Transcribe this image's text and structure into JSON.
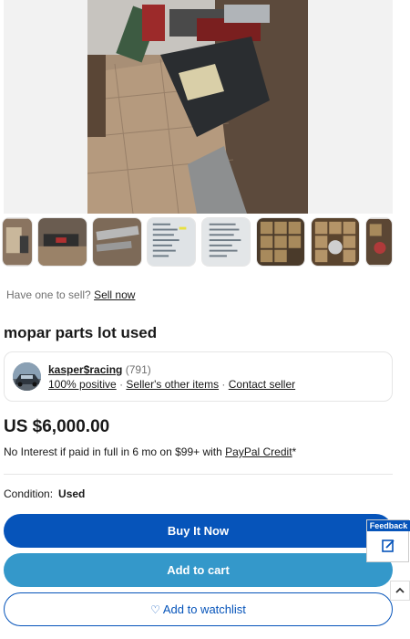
{
  "sell_prompt": {
    "text": "Have one to sell?",
    "link": "Sell now"
  },
  "listing": {
    "title": "mopar parts lot used"
  },
  "seller": {
    "name": "kasper$racing",
    "feedback_count": "(791)",
    "positive": "100% positive",
    "other_items": "Seller's other items",
    "contact": "Contact seller",
    "separator": "·"
  },
  "price": {
    "amount": "US $6,000.00"
  },
  "financing": {
    "text": "No Interest if paid in full in 6 mo on $99+ with",
    "link": "PayPal Credit",
    "suffix": "*"
  },
  "condition": {
    "label": "Condition:",
    "value": "Used"
  },
  "buttons": {
    "buy_now": "Buy It Now",
    "add_to_cart": "Add to cart",
    "watchlist": "Add to watchlist"
  },
  "feedback": {
    "label": "Feedback"
  },
  "icons": {
    "heart": "heart-icon",
    "feedback": "feedback-icon",
    "scroll_top": "chevron-up-icon"
  },
  "colors": {
    "primary_blue": "#0654ba",
    "secondary_blue": "#3498ca",
    "text": "#191919",
    "muted": "#707070"
  }
}
